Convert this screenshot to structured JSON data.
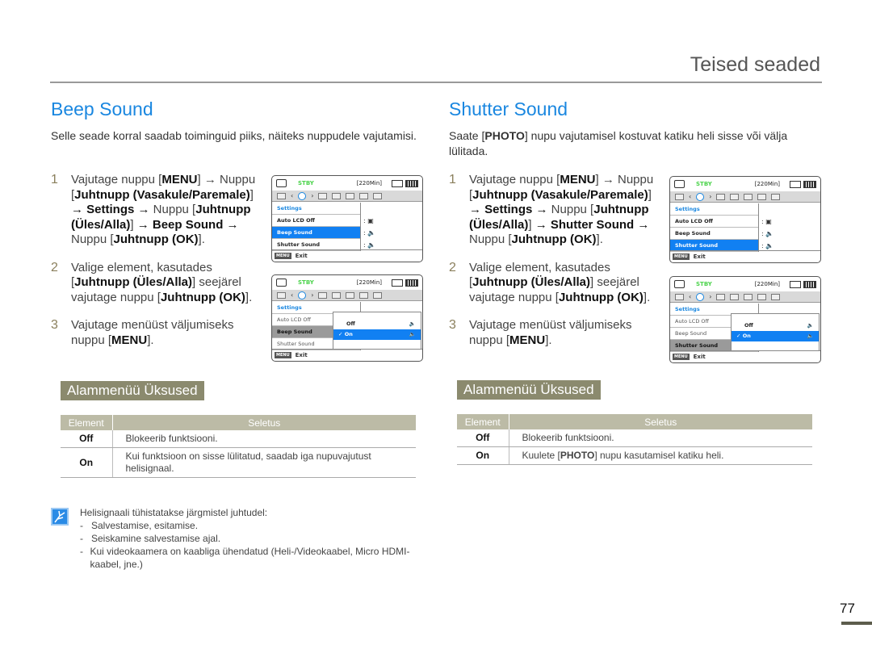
{
  "header": {
    "title": "Teised seaded"
  },
  "beep": {
    "title": "Beep Sound",
    "intro": "Selle seade korral saadab toiminguid piiks, näiteks nuppudele vajutamisi.",
    "steps": [
      {
        "num": "1",
        "parts": [
          "Vajutage nuppu [",
          "MENU",
          "] → Nuppu [",
          "Juhtnupp (Vasakule/Paremale)",
          "] ",
          "→ Settings →",
          " Nuppu [",
          "Juhtnupp (Üles/Alla)",
          "] ",
          "→ Beep Sound →",
          " Nuppu [",
          "Juhtnupp (OK)",
          "]."
        ]
      },
      {
        "num": "2",
        "parts": [
          "Valige element, kasutades [",
          "Juhtnupp (Üles/Alla)",
          "] seejärel vajutage nuppu [",
          "Juhtnupp (OK)",
          "]."
        ]
      },
      {
        "num": "3",
        "parts": [
          "Vajutage menüüst väljumiseks nuppu [",
          "MENU",
          "]."
        ]
      }
    ],
    "submenu_title": "Alammenüü Üksused",
    "table": {
      "headers": [
        "Element",
        "Seletus"
      ],
      "rows": [
        {
          "element": "Off",
          "desc": "Blokeerib funktsiooni."
        },
        {
          "element": "On",
          "desc": "Kui funktsioon on sisse lülitatud, saadab iga nupuvajutust helisignaal."
        }
      ]
    }
  },
  "shutter": {
    "title": "Shutter Sound",
    "intro_parts": [
      "Saate [",
      "PHOTO",
      "] nupu vajutamisel kostuvat katiku heli sisse või välja lülitada."
    ],
    "steps": [
      {
        "num": "1",
        "parts": [
          "Vajutage nuppu [",
          "MENU",
          "] → Nuppu [",
          "Juhtnupp (Vasakule/Paremale)",
          "] ",
          "→ Settings →",
          " Nuppu [",
          "Juhtnupp (Üles/Alla)",
          "] ",
          "→ Shutter Sound →",
          " Nuppu [",
          "Juhtnupp (OK)",
          "]."
        ]
      },
      {
        "num": "2",
        "parts": [
          "Valige element, kasutades [",
          "Juhtnupp (Üles/Alla)",
          "] seejärel vajutage nuppu [",
          "Juhtnupp (OK)",
          "]."
        ]
      },
      {
        "num": "3",
        "parts": [
          "Vajutage menüüst väljumiseks nuppu [",
          "MENU",
          "]."
        ]
      }
    ],
    "submenu_title": "Alammenüü Üksused",
    "table": {
      "headers": [
        "Element",
        "Seletus"
      ],
      "rows": [
        {
          "element": "Off",
          "desc_parts": [
            "Blokeerib funktsiooni."
          ]
        },
        {
          "element": "On",
          "desc_parts": [
            "Kuulete [",
            "PHOTO",
            "] nupu kasutamisel katiku heli."
          ]
        }
      ]
    }
  },
  "lcd": {
    "status": "STBY",
    "remaining": "[220Min]",
    "menu_header": "Settings",
    "items": [
      "Auto LCD Off",
      "Beep Sound",
      "Shutter Sound"
    ],
    "popup": [
      "Off",
      "On"
    ],
    "exit_key": "MENU",
    "exit_label": "Exit"
  },
  "note": {
    "intro": "Helisignaali tühistatakse järgmistel juhtudel:",
    "items": [
      "Salvestamise, esitamise.",
      "Seiskamine salvestamise ajal.",
      "Kui videokaamera on kaabliga ühendatud (Heli-/Videokaabel, Micro HDMI-kaabel, jne.)"
    ]
  },
  "page_number": "77",
  "colors": {
    "accent": "#1a87e0",
    "submenu_bg": "#8b8a6e",
    "table_header": "#bcbba6",
    "selection": "#1180f2",
    "stby": "#4bd34b"
  }
}
